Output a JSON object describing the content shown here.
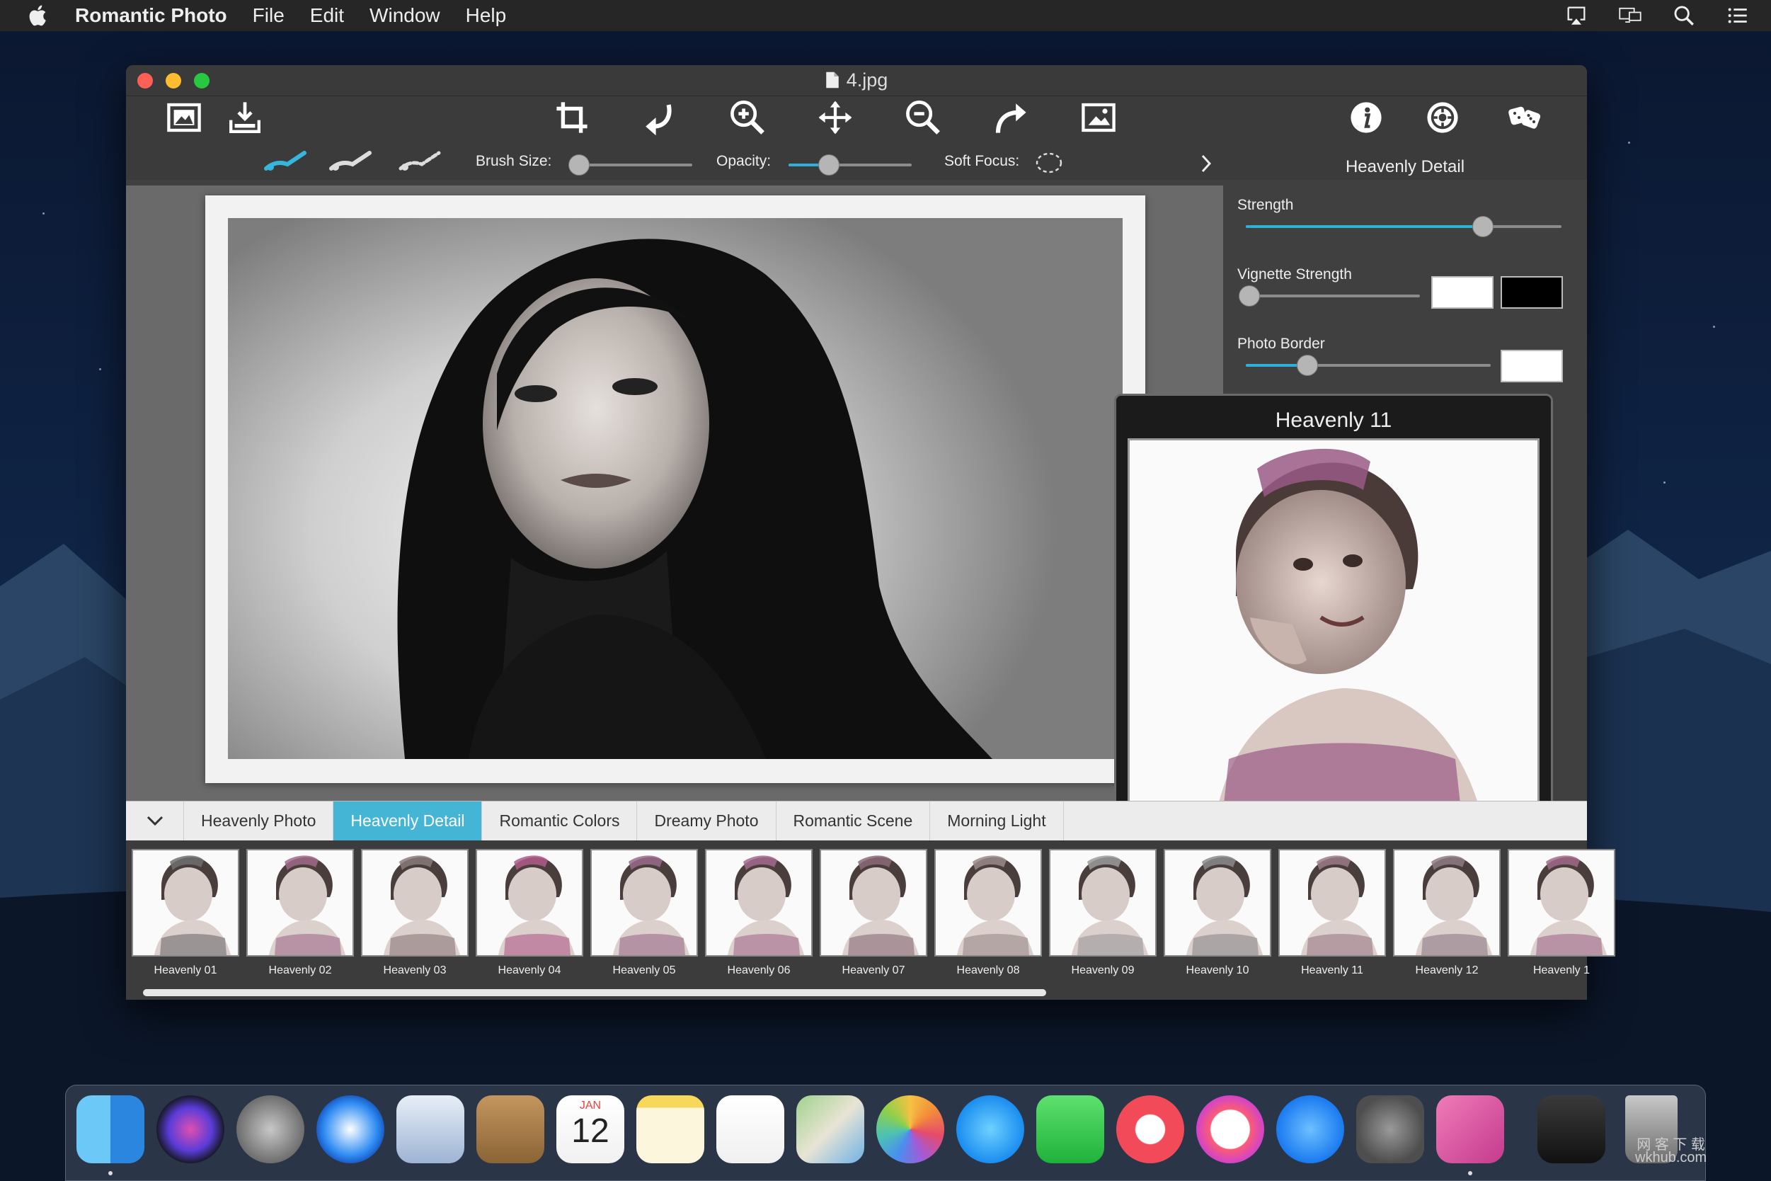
{
  "menubar": {
    "app_name": "Romantic Photo",
    "items": [
      "File",
      "Edit",
      "Window",
      "Help"
    ],
    "right_icons": [
      "airplay-icon",
      "display-icon",
      "spotlight-search-icon",
      "notification-center-icon"
    ]
  },
  "window": {
    "title": "4.jpg",
    "toolbar_icons": [
      "open-image-icon",
      "save-export-icon",
      "crop-icon",
      "rotate-left-icon",
      "zoom-in-icon",
      "move-icon",
      "zoom-out-icon",
      "rotate-right-icon",
      "fit-image-icon",
      "info-icon",
      "settings-icon",
      "random-dice-icon"
    ]
  },
  "options": {
    "brush_tools": [
      "brush-apply-icon",
      "brush-erase-icon",
      "brush-restore-icon"
    ],
    "brush_size_label": "Brush Size:",
    "brush_size_value": 0.05,
    "opacity_label": "Opacity:",
    "opacity_value": 0.33,
    "soft_focus_label": "Soft Focus:"
  },
  "panel": {
    "title": "Heavenly Detail",
    "strength_label": "Strength",
    "strength_value": 0.75,
    "vignette_label": "Vignette Strength",
    "vignette_value": 0.02,
    "vignette_colors": [
      "#ffffff",
      "#000000"
    ],
    "border_label": "Photo Border",
    "border_value": 0.25,
    "border_color": "#ffffff"
  },
  "preview": {
    "title": "Heavenly 11"
  },
  "tabs": {
    "items": [
      "Heavenly Photo",
      "Heavenly Detail",
      "Romantic Colors",
      "Dreamy Photo",
      "Romantic Scene",
      "Morning Light"
    ],
    "active": "Heavenly Detail"
  },
  "thumbnails": [
    "Heavenly 01",
    "Heavenly 02",
    "Heavenly 03",
    "Heavenly 04",
    "Heavenly 05",
    "Heavenly 06",
    "Heavenly 07",
    "Heavenly 08",
    "Heavenly 09",
    "Heavenly 10",
    "Heavenly 11",
    "Heavenly 12",
    "Heavenly 1"
  ],
  "dock": {
    "apps": [
      "finder-icon",
      "siri-icon",
      "launchpad-icon",
      "safari-icon",
      "mail-icon",
      "contacts-icon",
      "calendar-icon",
      "notes-icon",
      "reminders-icon",
      "maps-icon",
      "photos-icon",
      "messages-icon",
      "facetime-icon",
      "news-icon",
      "music-icon",
      "app-store-icon",
      "system-preferences-icon",
      "romantic-photo-icon",
      "downloads-stack-icon",
      "trash-icon"
    ],
    "calendar_month": "JAN",
    "calendar_day": "12"
  },
  "watermark": {
    "line1": "网 客 下 载",
    "line2": "wkhub.com"
  },
  "colors": {
    "accent": "#45b5d6",
    "slider_fill": "#2fb0d8"
  }
}
